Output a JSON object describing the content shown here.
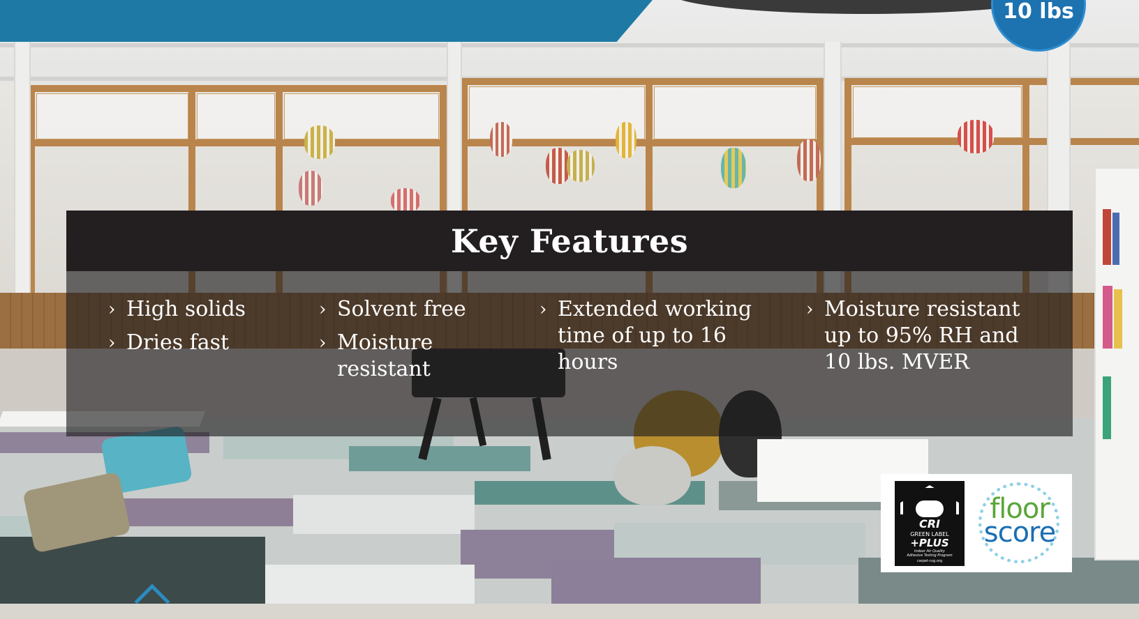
{
  "badge": {
    "text": "10 lbs"
  },
  "features": {
    "title": "Key Features",
    "chevron": "›",
    "columns": [
      {
        "items": [
          "High solids",
          "Dries fast"
        ]
      },
      {
        "items": [
          "Solvent free",
          "Moisture resistant"
        ]
      },
      {
        "items": [
          "Extended working time of up to 16 hours"
        ]
      },
      {
        "items": [
          "Moisture resistant up to 95% RH and 10 lbs. MVER"
        ]
      }
    ]
  },
  "certifications": {
    "cri": {
      "name": "CRI",
      "line1": "GREEN LABEL",
      "line2": "+PLUS",
      "line3": "Indoor Air Quality",
      "line4": "Adhesive Testing Program",
      "line5": "carpet-rug.org"
    },
    "floorscore": {
      "word1": "floor",
      "word2": "score"
    }
  },
  "colors": {
    "banner_blue": "#1e7aa5",
    "badge_blue": "#1d72b0",
    "panel_dark": "#231f20",
    "floorscore_green": "#5aa63a",
    "floorscore_blue": "#1a6fb3"
  }
}
